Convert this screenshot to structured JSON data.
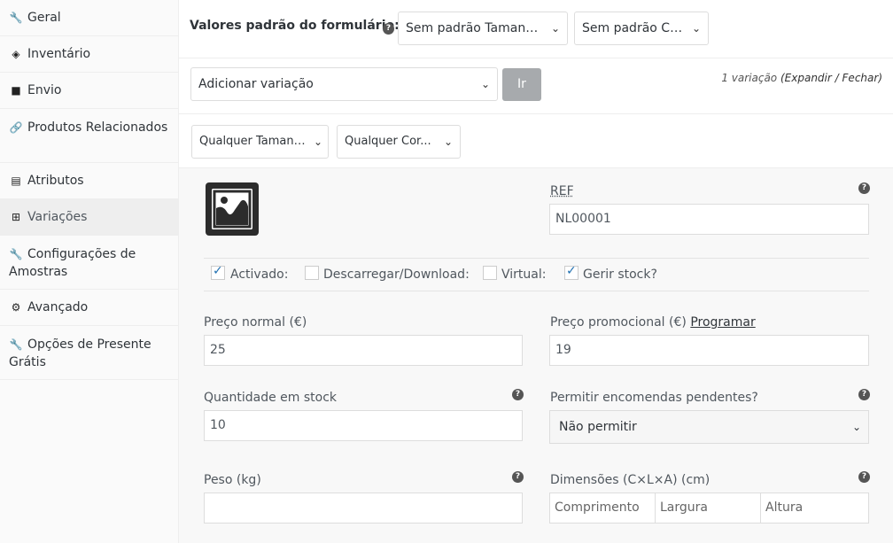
{
  "sidebar": {
    "items": [
      {
        "label": "Geral",
        "icon": "wrench-icon",
        "glyph": "🔧"
      },
      {
        "label": "Inventário",
        "icon": "tag-icon",
        "glyph": "◈"
      },
      {
        "label": "Envio",
        "icon": "truck-icon",
        "glyph": "■"
      },
      {
        "label": "Produtos Relacionados",
        "icon": "link-icon",
        "glyph": "🔗"
      },
      {
        "label": "Atributos",
        "icon": "list-table-icon",
        "glyph": "▤"
      },
      {
        "label": "Variações",
        "icon": "grid-icon",
        "glyph": "⊞"
      },
      {
        "label": "Configurações de Amostras",
        "icon": "wrench-icon",
        "glyph": "🔧"
      },
      {
        "label": "Avançado",
        "icon": "gear-icon",
        "glyph": "⚙"
      },
      {
        "label": "Opções de Presente Grátis",
        "icon": "wrench-icon",
        "glyph": "🔧"
      }
    ],
    "active_index": 5
  },
  "defaults": {
    "label": "Valores padrão do formulário:",
    "size_select": "Sem padrão Tamanho...",
    "color_select": "Sem padrão Cor..."
  },
  "actions": {
    "select": "Adicionar variação",
    "go_label": "Ir",
    "count_text": "1 variação",
    "expand": "Expandir",
    "separator": "/",
    "close": "Fechar"
  },
  "variation": {
    "size_select": "Qualquer Tamanho...",
    "color_select": "Qualquer Cor...",
    "sku_label": "REF",
    "sku_value": "NL00001",
    "checkboxes": {
      "enabled": {
        "label": "Activado:",
        "checked": true
      },
      "downloadable": {
        "label": "Descarregar/Download:",
        "checked": false
      },
      "virtual": {
        "label": "Virtual:",
        "checked": false
      },
      "manage_stock": {
        "label": "Gerir stock?",
        "checked": true
      }
    },
    "regular_price_label": "Preço normal (€)",
    "regular_price": "25",
    "sale_price_label": "Preço promocional (€)",
    "schedule_link": "Programar",
    "sale_price": "19",
    "stock_qty_label": "Quantidade em stock",
    "stock_qty": "10",
    "backorders_label": "Permitir encomendas pendentes?",
    "backorders_value": "Não permitir",
    "weight_label": "Peso (kg)",
    "weight_value": "",
    "dimensions_label": "Dimensões (C×L×A) (cm)",
    "length_placeholder": "Comprimento",
    "width_placeholder": "Largura",
    "height_placeholder": "Altura"
  },
  "colors": {
    "accent": "#2271b1",
    "button_disabled": "#a7aaad"
  }
}
